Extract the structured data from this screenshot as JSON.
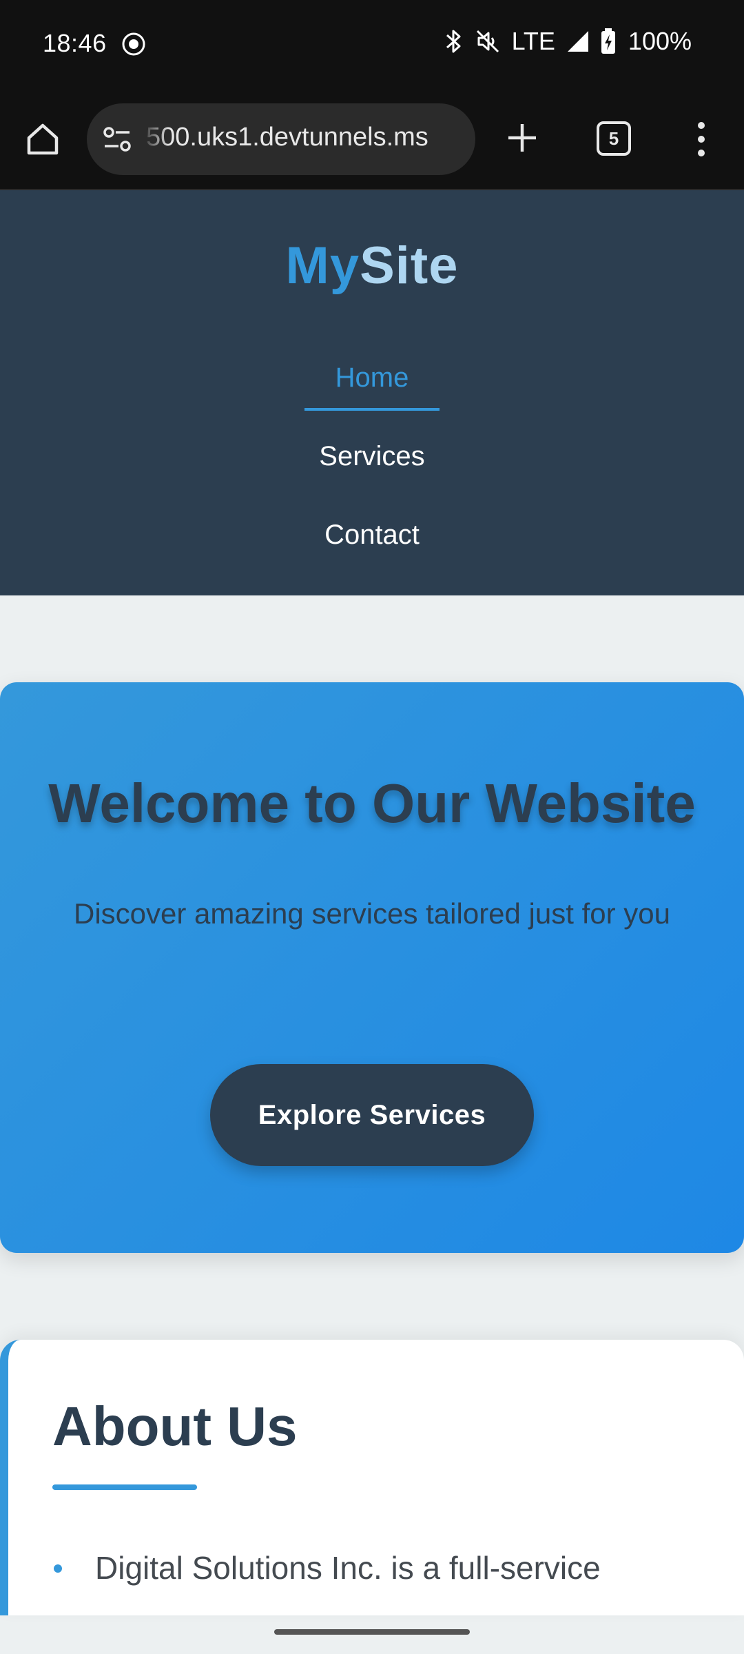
{
  "status_bar": {
    "time": "18:46",
    "network": "LTE",
    "battery": "100%",
    "icons": [
      "screen-record-icon",
      "bluetooth-icon",
      "mute-icon",
      "signal-icon",
      "battery-charging-icon"
    ]
  },
  "browser": {
    "url": "500.uks1.devtunnels.ms",
    "tab_count": "5",
    "icons": [
      "home-icon",
      "site-settings-icon",
      "new-tab-icon",
      "tabs-icon",
      "more-icon"
    ]
  },
  "site": {
    "logo": {
      "part1": "My",
      "part2": "Site"
    },
    "nav": [
      {
        "label": "Home",
        "active": true
      },
      {
        "label": "Services",
        "active": false
      },
      {
        "label": "Contact",
        "active": false
      }
    ],
    "hero": {
      "title": "Welcome to Our Website",
      "subtitle": "Discover amazing services tailored just for you",
      "button": "Explore Services"
    },
    "about": {
      "title": "About Us",
      "items": [
        "Digital Solutions Inc. is a full-service"
      ]
    }
  },
  "colors": {
    "header_bg": "#2c3e50",
    "accent": "#3498db",
    "hero_gradient_end": "#1e88e5",
    "page_bg": "#ecf0f1"
  }
}
